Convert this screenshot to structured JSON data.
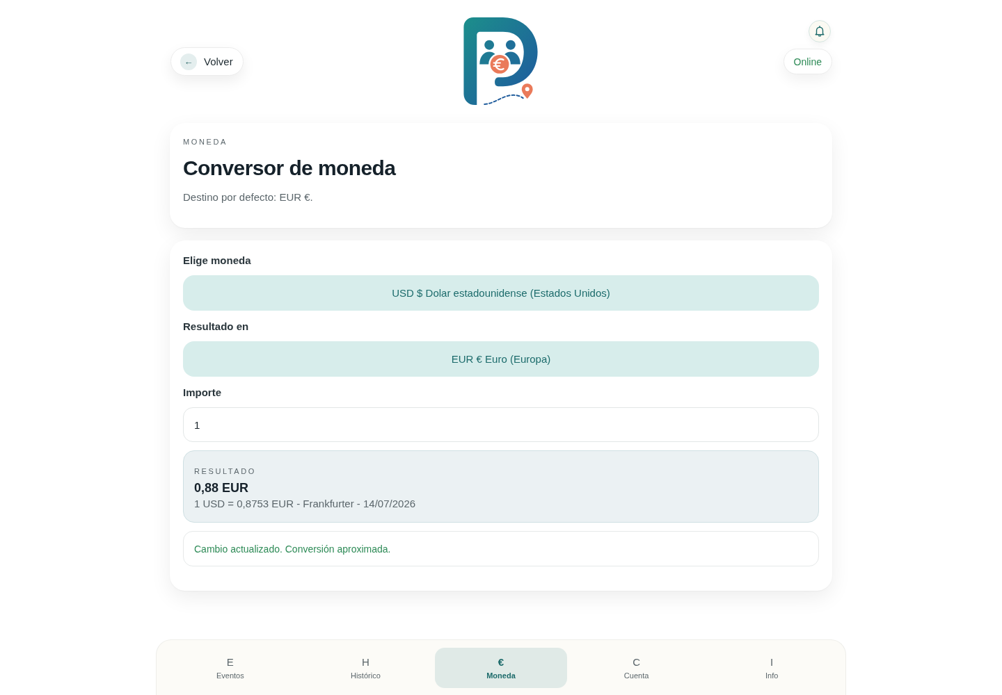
{
  "header": {
    "back_button": {
      "icon": "←",
      "label": "Volver"
    },
    "status": "Online"
  },
  "intro_card": {
    "eyebrow": "MONEDA",
    "title": "Conversor de moneda",
    "description": "Destino por defecto: EUR €."
  },
  "converter": {
    "fields": [
      {
        "kind": "select",
        "label": "Elige moneda",
        "value": "USD $ Dolar estadounidense (Estados Unidos)"
      },
      {
        "kind": "select",
        "label": "Resultado en",
        "value": "EUR € Euro (Europa)"
      },
      {
        "kind": "input",
        "label": "Importe",
        "value": "1"
      }
    ],
    "result": {
      "eyebrow": "RESULTADO",
      "amount": "0,88 EUR",
      "detail": "1 USD = 0,8753 EUR - Frankfurter - 14/07/2026"
    },
    "notice": "Cambio actualizado. Conversión aproximada."
  },
  "nav": [
    {
      "glyph": "E",
      "label": "Eventos",
      "selected": false
    },
    {
      "glyph": "H",
      "label": "Histórico",
      "selected": false
    },
    {
      "glyph": "€",
      "label": "Moneda",
      "selected": true
    },
    {
      "glyph": "C",
      "label": "Cuenta",
      "selected": false
    },
    {
      "glyph": "I",
      "label": "Info",
      "selected": false
    }
  ]
}
